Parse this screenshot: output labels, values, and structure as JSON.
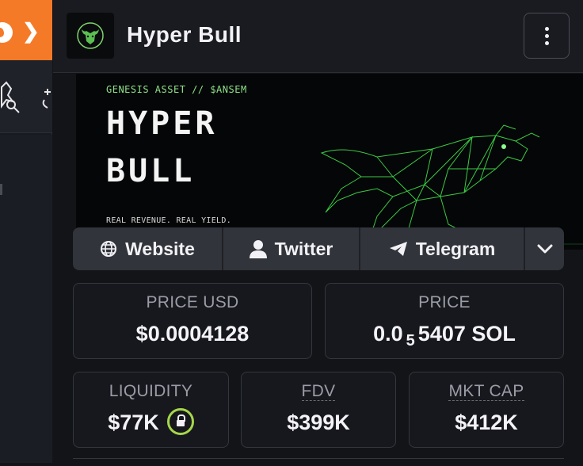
{
  "rail": {
    "expand_icon": "chevron-right-icon",
    "fire_icon": "fire-icon"
  },
  "header": {
    "title": "Hyper Bull",
    "menu_icon": "kebab-menu-icon"
  },
  "banner": {
    "tag": "GENESIS ASSET // $ANSEM",
    "line1": "HYPER",
    "line2": "BULL",
    "subtitle": "REAL REVENUE. REAL YIELD."
  },
  "socials": {
    "website": "Website",
    "twitter": "Twitter",
    "telegram": "Telegram"
  },
  "stats": {
    "price_usd_label": "PRICE USD",
    "price_usd_value": "$0.0004128",
    "price_label": "PRICE",
    "price_prefix": "0.0",
    "price_zeros": "5",
    "price_digits": "5407 SOL",
    "liquidity_label": "LIQUIDITY",
    "liquidity_value": "$77K",
    "fdv_label": "FDV",
    "fdv_value": "$399K",
    "mktcap_label": "MKT CAP",
    "mktcap_value": "$412K"
  },
  "colors": {
    "accent_orange": "#f57a28",
    "lock_green": "#a6d64a",
    "banner_green": "#8fe28a"
  }
}
